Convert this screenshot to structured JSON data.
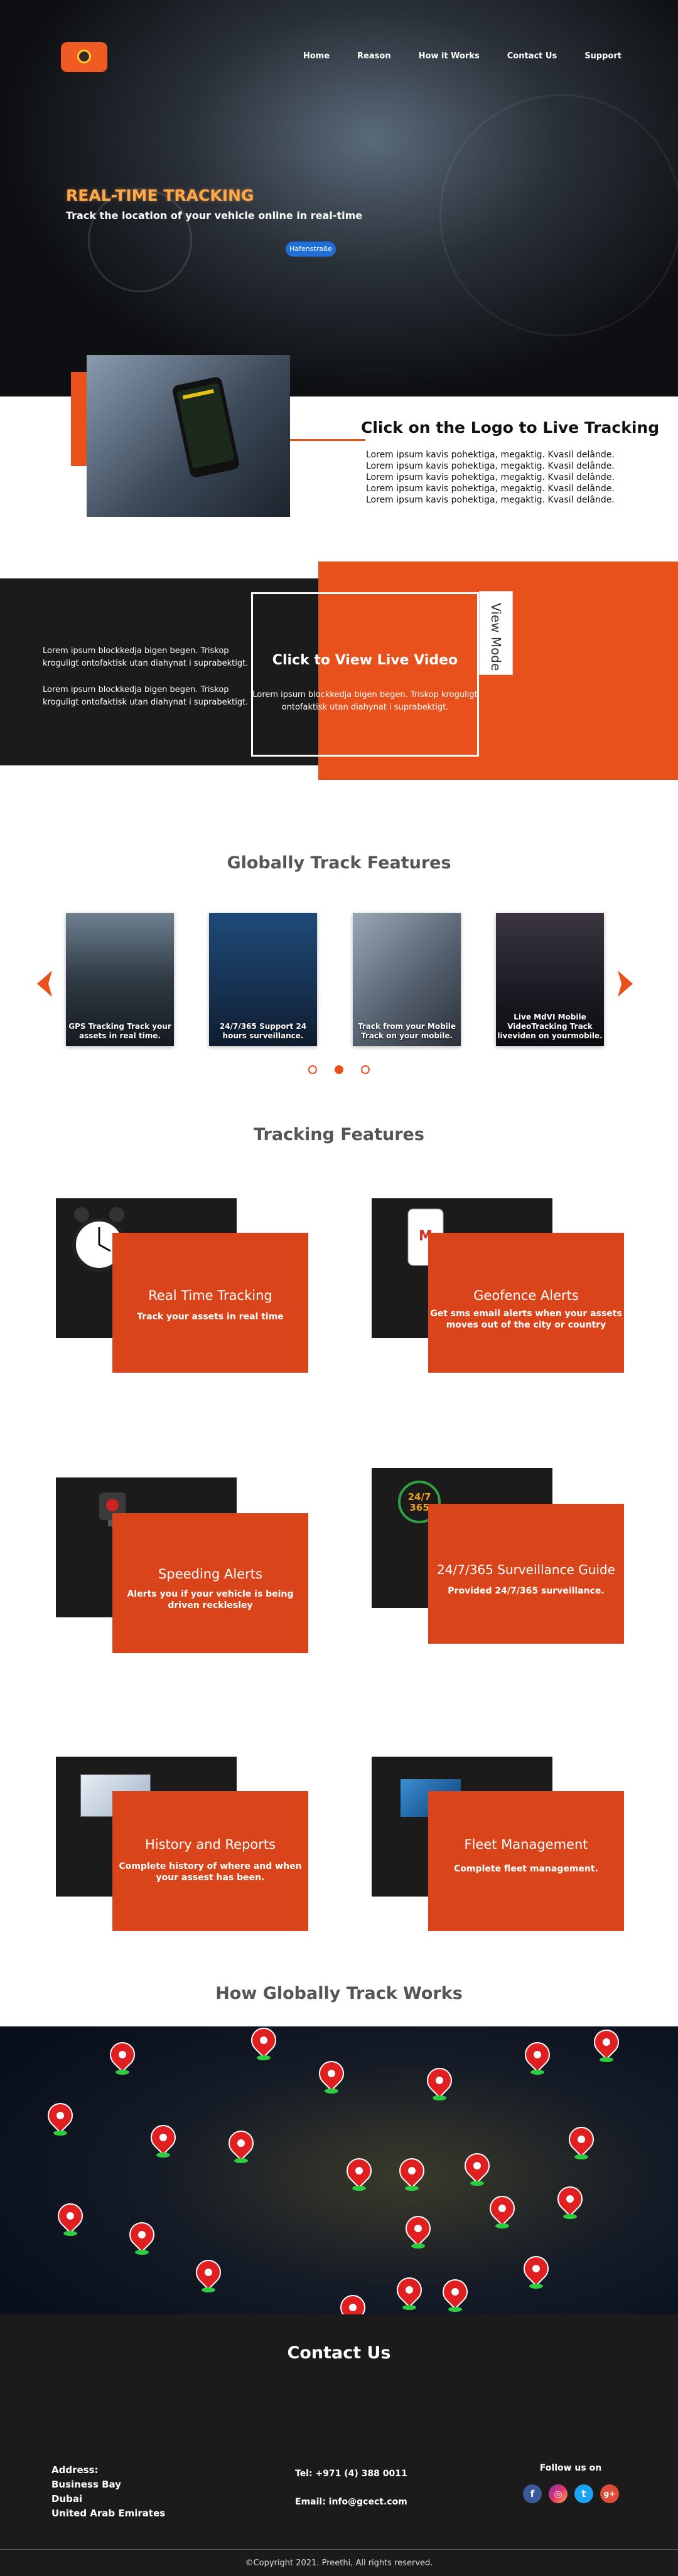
{
  "nav": {
    "home": "Home",
    "reason": "Reason",
    "how": "How it Works",
    "contact": "Contact Us",
    "support": "Support"
  },
  "hero": {
    "title": "REAL-TIME TRACKING",
    "subtitle": "Track the location of your vehicle online in real-time",
    "map_label": "Hafenstraße"
  },
  "live_tracking": {
    "title": "Click on the Logo to Live Tracking",
    "text": "Lorem ipsum kavis pohektiga, megaktig. Kvasil delânde.  Lorem ipsum kavis pohektiga, megaktig. Kvasil delânde.  Lorem ipsum kavis pohektiga, megaktig. Kvasil delânde.  Lorem ipsum kavis pohektiga, megaktig. Kvasil delânde.  Lorem ipsum kavis pohektiga, megaktig. Kvasil delânde."
  },
  "live_video": {
    "left_p1": "Lorem ipsum blockkedja bigen begen. Triskop kroguligt ontofaktisk utan diahynat i suprabektigt.",
    "left_p2": "Lorem ipsum blockkedja bigen begen. Triskop kroguligt ontofaktisk utan diahynat i suprabektigt.",
    "box_title": "Click to View Live Video",
    "box_text": "Lorem ipsum blockkedja bigen begen. Triskop kroguligt ontofaktisk utan diahynat i suprabektigt.",
    "view_mode": "View Mode"
  },
  "globally": {
    "title": "Globally Track Features",
    "cards": [
      {
        "caption": "GPS Tracking  Track your assets  in real time."
      },
      {
        "caption": "24/7/365 Support 24 hours surveillance."
      },
      {
        "caption": "Track from your Mobile Track on your mobile."
      },
      {
        "caption": "Live MdVI Mobile VideoTracking  Track liveviden on yourmobile."
      }
    ]
  },
  "tracking": {
    "title": "Tracking Features",
    "features": [
      {
        "title": "Real Time Tracking",
        "desc": "Track your assets in real time"
      },
      {
        "title": "Geofence Alerts",
        "desc": "Get sms email alerts when your assets moves out of the city or country"
      },
      {
        "title": "Speeding Alerts",
        "desc": "Alerts you if your vehicle is being driven recklesley"
      },
      {
        "title": "24/7/365 Surveillance Guide",
        "desc": "Provided 24/7/365 surveillance."
      },
      {
        "title": "History and Reports",
        "desc": "Complete history of where and when your assest has been."
      },
      {
        "title": "Fleet Management",
        "desc": "Complete fleet management."
      }
    ],
    "icon_247": "24/7 365"
  },
  "how": {
    "title": "How Globally Track Works"
  },
  "contact": {
    "title": "Contact Us",
    "address_label": "Address:",
    "address_lines": [
      "Business Bay",
      "Dubai",
      "United Arab Emirates"
    ],
    "tel": "Tel: +971 (4) 388 0011",
    "email": "Email: info@gcect.com",
    "follow": "Follow us on",
    "copyright": "©Copyright 2021. Preethi, All rights reserved."
  },
  "colors": {
    "accent": "#e8511c",
    "dark": "#1b1b1b",
    "hero_title": "#ffa94d"
  }
}
